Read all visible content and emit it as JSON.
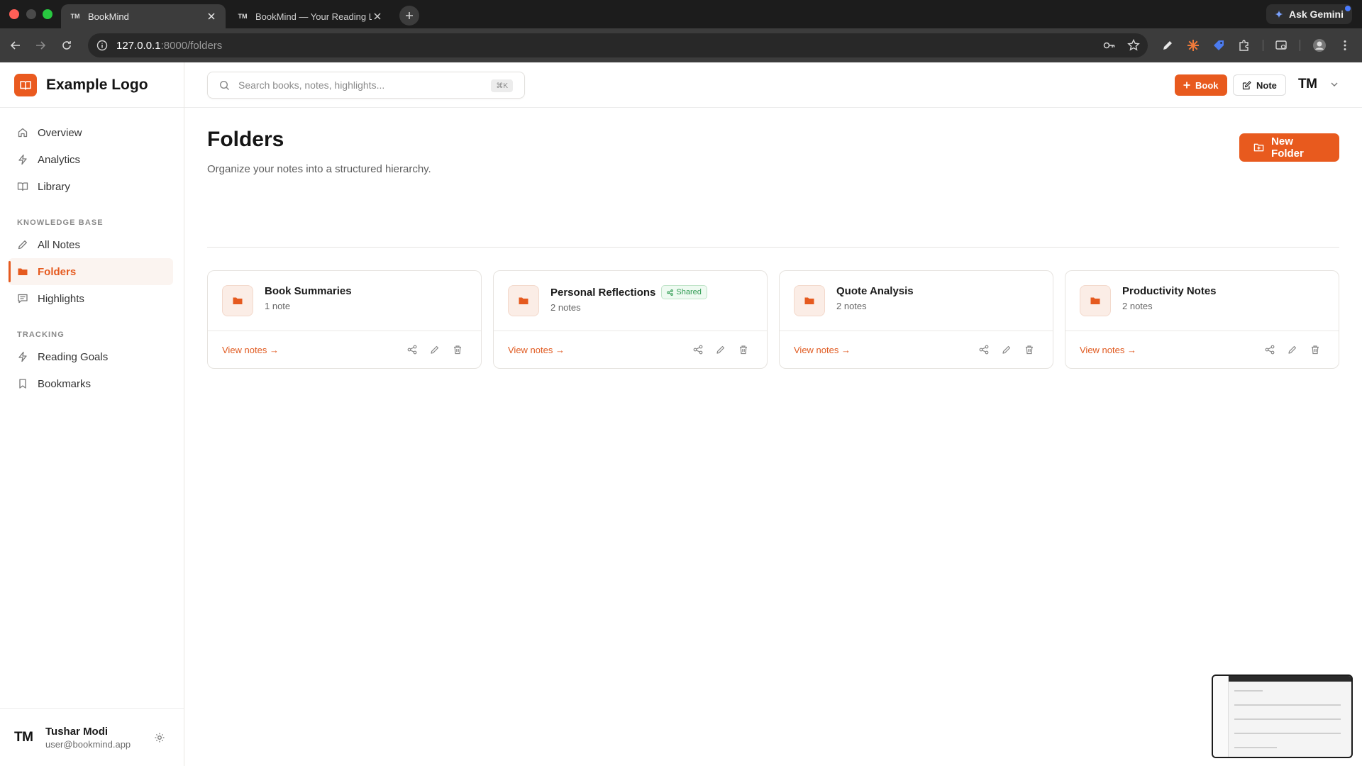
{
  "browser": {
    "tabs": [
      {
        "favicon": "TM",
        "title": "BookMind",
        "active": true
      },
      {
        "favicon": "TM",
        "title": "BookMind — Your Reading Lif",
        "active": false
      }
    ],
    "url_host": "127.0.0.1",
    "url_rest": ":8000/folders",
    "gemini_label": "Ask Gemini"
  },
  "brand": {
    "name": "Example Logo",
    "accent": "#e85a1e"
  },
  "sidebar": {
    "primary": [
      {
        "label": "Overview",
        "icon": "home-icon"
      },
      {
        "label": "Analytics",
        "icon": "activity-icon"
      },
      {
        "label": "Library",
        "icon": "book-open-icon"
      }
    ],
    "sections": [
      {
        "title": "KNOWLEDGE BASE",
        "items": [
          {
            "label": "All Notes",
            "icon": "pencil-icon"
          },
          {
            "label": "Folders",
            "icon": "folder-icon",
            "active": true
          },
          {
            "label": "Highlights",
            "icon": "message-icon"
          }
        ]
      },
      {
        "title": "TRACKING",
        "items": [
          {
            "label": "Reading Goals",
            "icon": "activity-icon"
          },
          {
            "label": "Bookmarks",
            "icon": "bookmark-icon"
          }
        ]
      }
    ],
    "user": {
      "initials": "TM",
      "name": "Tushar Modi",
      "email": "user@bookmind.app"
    }
  },
  "topbar": {
    "search_placeholder": "Search books, notes, highlights...",
    "search_shortcut": "⌘K",
    "book_button": "Book",
    "note_button": "Note",
    "avatar_initials": "TM"
  },
  "page": {
    "title": "Folders",
    "subtitle": "Organize your notes into a structured hierarchy.",
    "new_folder_button": "New Folder"
  },
  "folders": [
    {
      "name": "Book Summaries",
      "count": "1 note",
      "shared": false,
      "link": "View notes →"
    },
    {
      "name": "Personal Reflections",
      "count": "2 notes",
      "shared": true,
      "badge": "Shared",
      "link": "View notes →"
    },
    {
      "name": "Quote Analysis",
      "count": "2 notes",
      "shared": false,
      "link": "View notes →"
    },
    {
      "name": "Productivity Notes",
      "count": "2 notes",
      "shared": false,
      "link": "View notes →"
    }
  ]
}
